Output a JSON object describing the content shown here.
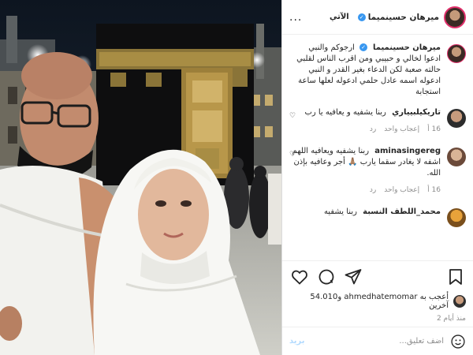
{
  "colors": {
    "accent": "#3897f0",
    "story_ring": "#e1306c",
    "muted": "#8e8e8e",
    "post_disabled": "#b3dbff"
  },
  "header": {
    "username": "ميرهان حسينميما",
    "follow": "الآتي",
    "more": "..."
  },
  "post": {
    "username": "ميرهان حسينميما",
    "caption": "ارجوكم والنبي ادعوا لخالي و حبيبي ومن اقرب الناس لقلبي حالته صعبة لكن الدعاء بغير القدر و النبي ادعوله اسمه عادل حلمي ادعوله لعلها ساعة استجابة"
  },
  "comments": [
    {
      "username": "تاريكيلبيياري",
      "text": "ربنا يشفيه و يعافيه يا رب",
      "time": "16 أ",
      "likes": "إعجاب واحد",
      "reply": "رد"
    },
    {
      "username": "aminasingereg",
      "text": "ربنا يشفيه ويعافيه اللهم اشفه لا يغادر سقما يارب 🙏🏽 أجر وعافيه بإذن الله.",
      "time": "16 أ",
      "likes": "إعجاب واحد",
      "reply": "رد"
    },
    {
      "username": "محمد_اللطف النسبة",
      "text": "ربنا يشفيه",
      "time": "",
      "likes": "",
      "reply": ""
    }
  ],
  "likes_line": "أعجب به ahmedhatemomar و54.010 آخرين",
  "date": "منذ أيام 2",
  "add_comment": {
    "placeholder": "اضف تعليق...",
    "post": "بريد"
  }
}
